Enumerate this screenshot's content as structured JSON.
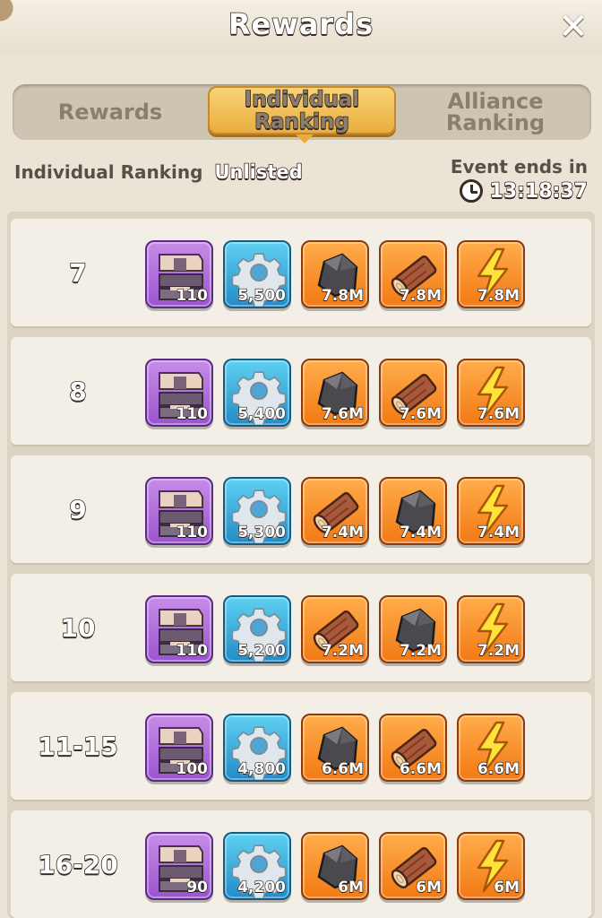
{
  "header": {
    "title": "Rewards"
  },
  "tabs": [
    {
      "label": "Rewards"
    },
    {
      "label_line1": "Individual",
      "label_line2": "Ranking"
    },
    {
      "label_line1": "Alliance",
      "label_line2": "Ranking"
    }
  ],
  "status": {
    "label": "Individual Ranking",
    "value": "Unlisted",
    "event_label": "Event ends in",
    "timer": "13:18:37"
  },
  "colors": {
    "purple_tier": "#9b54cf",
    "blue_tier": "#1f8dc8",
    "orange_tier": "#f27a14",
    "active_tab": "#e9ad3f"
  },
  "rows": [
    {
      "rank": "7",
      "items": [
        {
          "icon": "lockbox-icon",
          "qty": "110"
        },
        {
          "icon": "gear-icon",
          "qty": "5,500"
        },
        {
          "icon": "ore-icon",
          "qty": "7.8M"
        },
        {
          "icon": "wood-log-icon",
          "qty": "7.8M"
        },
        {
          "icon": "lightning-icon",
          "qty": "7.8M"
        }
      ]
    },
    {
      "rank": "8",
      "items": [
        {
          "icon": "lockbox-icon",
          "qty": "110"
        },
        {
          "icon": "gear-icon",
          "qty": "5,400"
        },
        {
          "icon": "ore-icon",
          "qty": "7.6M"
        },
        {
          "icon": "wood-log-icon",
          "qty": "7.6M"
        },
        {
          "icon": "lightning-icon",
          "qty": "7.6M"
        }
      ]
    },
    {
      "rank": "9",
      "items": [
        {
          "icon": "lockbox-icon",
          "qty": "110"
        },
        {
          "icon": "gear-icon",
          "qty": "5,300"
        },
        {
          "icon": "wood-log-icon",
          "qty": "7.4M"
        },
        {
          "icon": "ore-icon",
          "qty": "7.4M"
        },
        {
          "icon": "lightning-icon",
          "qty": "7.4M"
        }
      ]
    },
    {
      "rank": "10",
      "items": [
        {
          "icon": "lockbox-icon",
          "qty": "110"
        },
        {
          "icon": "gear-icon",
          "qty": "5,200"
        },
        {
          "icon": "wood-log-icon",
          "qty": "7.2M"
        },
        {
          "icon": "ore-icon",
          "qty": "7.2M"
        },
        {
          "icon": "lightning-icon",
          "qty": "7.2M"
        }
      ]
    },
    {
      "rank": "11-15",
      "items": [
        {
          "icon": "lockbox-icon",
          "qty": "100"
        },
        {
          "icon": "gear-icon",
          "qty": "4,800"
        },
        {
          "icon": "ore-icon",
          "qty": "6.6M"
        },
        {
          "icon": "wood-log-icon",
          "qty": "6.6M"
        },
        {
          "icon": "lightning-icon",
          "qty": "6.6M"
        }
      ]
    },
    {
      "rank": "16-20",
      "items": [
        {
          "icon": "lockbox-icon",
          "qty": "90"
        },
        {
          "icon": "gear-icon",
          "qty": "4,200"
        },
        {
          "icon": "ore-icon",
          "qty": "6M"
        },
        {
          "icon": "wood-log-icon",
          "qty": "6M"
        },
        {
          "icon": "lightning-icon",
          "qty": "6M"
        }
      ]
    }
  ]
}
